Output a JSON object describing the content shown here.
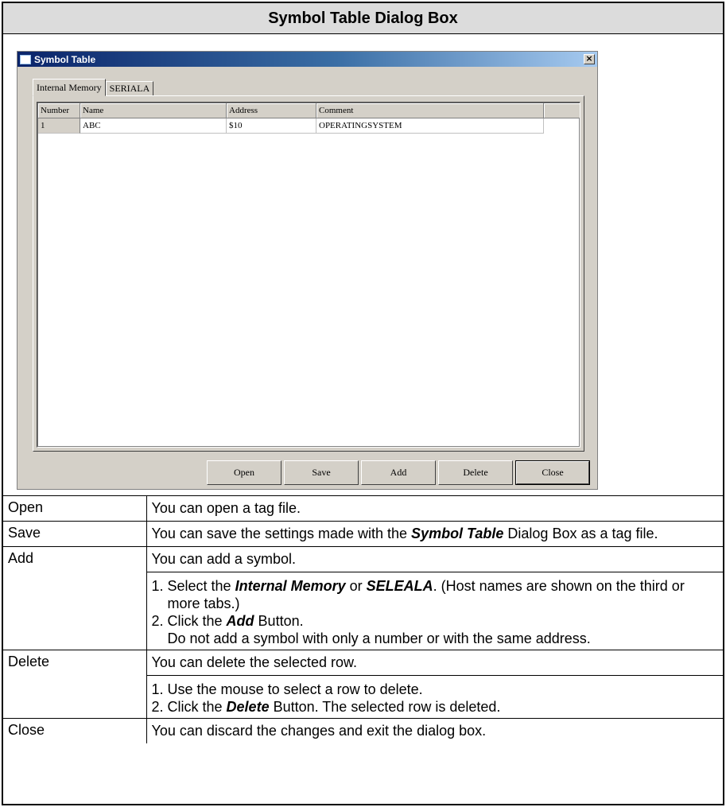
{
  "heading": "Symbol Table Dialog Box",
  "dialog": {
    "title": "Symbol Table",
    "close_glyph": "×",
    "tabs": [
      "Internal Memory",
      "SERIALA"
    ],
    "columns": [
      "Number",
      "Name",
      "Address",
      "Comment"
    ],
    "rows": [
      {
        "number": "1",
        "name": "ABC",
        "address": "$10",
        "comment": "OPERATINGSYSTEM"
      }
    ],
    "buttons": {
      "open": "Open",
      "save": "Save",
      "add": "Add",
      "delete": "Delete",
      "close": "Close"
    }
  },
  "descriptions": {
    "open": {
      "label": "Open",
      "text": "You can open a tag file."
    },
    "save": {
      "label": "Save",
      "pre": "You can save the settings made with the ",
      "em": "Symbol Table",
      "post": " Dialog Box as a tag file."
    },
    "add": {
      "label": "Add",
      "text": "You can add a symbol.",
      "step1_pre": "1. Select the ",
      "step1_em1": "Internal Memory",
      "step1_mid": " or ",
      "step1_em2": "SELEALA",
      "step1_post": ". (Host names are shown on the third or more tabs.)",
      "step2_pre": "2. Click the ",
      "step2_em": "Add",
      "step2_post": " Button.",
      "step2_note": "Do not add a symbol with only a number or with the same address."
    },
    "delete": {
      "label": "Delete",
      "text": "You can delete the selected row.",
      "step1": "1. Use the mouse to select a row to delete.",
      "step2_pre": "2. Click the ",
      "step2_em": "Delete",
      "step2_post": " Button. The selected row is deleted."
    },
    "close": {
      "label": "Close",
      "text": "You can discard the changes and exit the dialog box."
    }
  }
}
